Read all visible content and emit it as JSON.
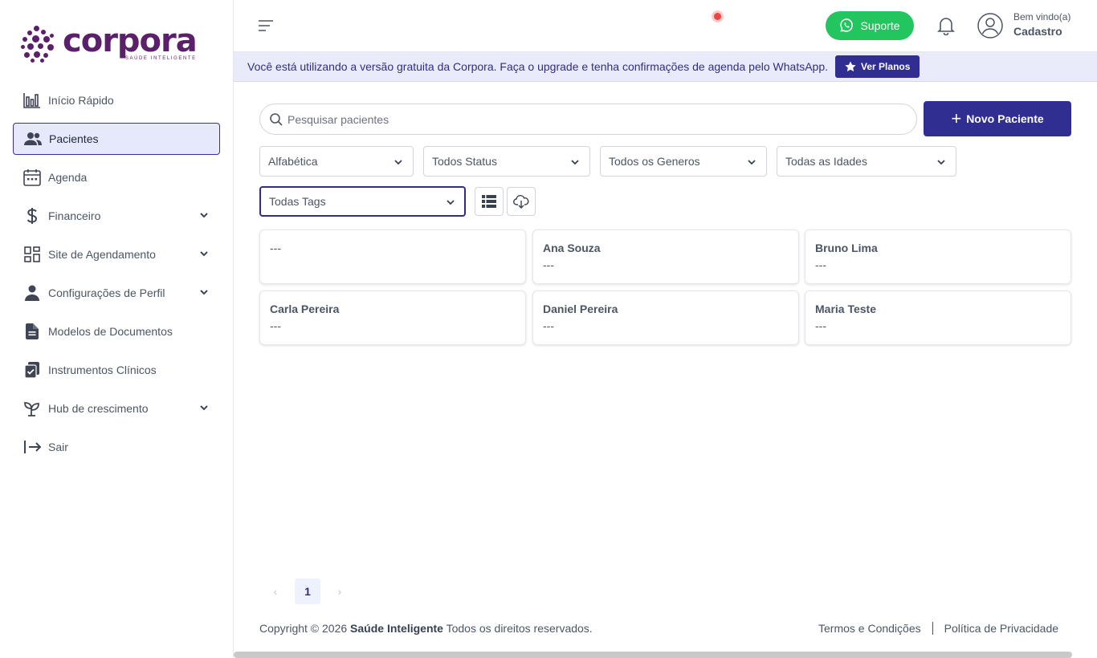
{
  "app": {
    "logo_word": "corpora",
    "logo_tagline": "SAÚDE INTELIGENTE"
  },
  "sidebar": {
    "items": [
      {
        "label": "Início Rápido",
        "icon": "chart-bar-icon",
        "active": false,
        "has_submenu": false
      },
      {
        "label": "Pacientes",
        "icon": "users-icon",
        "active": true,
        "has_submenu": false
      },
      {
        "label": "Agenda",
        "icon": "calendar-icon",
        "active": false,
        "has_submenu": false
      },
      {
        "label": "Financeiro",
        "icon": "dollar-icon",
        "active": false,
        "has_submenu": true
      },
      {
        "label": "Site de Agendamento",
        "icon": "dashboard-grid-icon",
        "active": false,
        "has_submenu": true
      },
      {
        "label": "Configurações de Perfil",
        "icon": "user-icon",
        "active": false,
        "has_submenu": true
      },
      {
        "label": "Modelos de Documentos",
        "icon": "document-icon",
        "active": false,
        "has_submenu": false
      },
      {
        "label": "Instrumentos Clínicos",
        "icon": "clipboard-check-icon",
        "active": false,
        "has_submenu": false
      },
      {
        "label": "Hub de crescimento",
        "icon": "sprout-icon",
        "active": false,
        "has_submenu": true
      },
      {
        "label": "Sair",
        "icon": "logout-icon",
        "active": false,
        "has_submenu": false
      }
    ]
  },
  "header": {
    "support_label": "Suporte",
    "welcome_text": "Bem vindo(a)",
    "user_name": "Cadastro"
  },
  "banner": {
    "text": "Você está utilizando a versão gratuita da Corpora. Faça o upgrade e tenha confirmações de agenda pelo WhatsApp.",
    "button_label": "Ver Planos"
  },
  "main": {
    "search_placeholder": "Pesquisar pacientes",
    "new_patient_label": "Novo Paciente",
    "filters": {
      "sort": "Alfabética",
      "status": "Todos Status",
      "gender": "Todos os Generos",
      "age": "Todas as Idades",
      "tags": "Todas Tags"
    },
    "patients": [
      {
        "name": "",
        "info": "---"
      },
      {
        "name": "Ana Souza",
        "info": "---"
      },
      {
        "name": "Bruno Lima",
        "info": "---"
      },
      {
        "name": "Carla Pereira",
        "info": "---"
      },
      {
        "name": "Daniel Pereira",
        "info": "---"
      },
      {
        "name": "Maria Teste",
        "info": "---"
      }
    ],
    "pagination": {
      "current_page": "1",
      "prev": "‹",
      "next": "›"
    }
  },
  "footer": {
    "copyright_prefix": "Copyright © 2026",
    "company": "Saúde Inteligente",
    "copyright_suffix": "Todos os direitos reservados.",
    "terms": "Termos e Condições",
    "privacy": "Política de Privacidade"
  },
  "colors": {
    "primary": "#312e91",
    "brand": "#5b1f6b",
    "support": "#22c55e",
    "banner_bg": "#e9ebfb",
    "active_nav_bg": "#e6e8fb"
  }
}
